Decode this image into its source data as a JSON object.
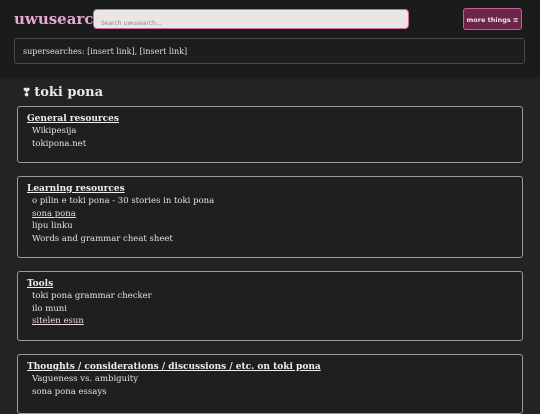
{
  "header": {
    "brand": "uwusearch",
    "search_placeholder": "Search uwusearch...",
    "more_button": "more things ≡"
  },
  "supersearches": "supersearches: [insert link], [insert link]",
  "page": {
    "title": "toki pona",
    "title_icon": "❣"
  },
  "sections": [
    {
      "heading": "General resources",
      "items": [
        "Wikipesija",
        "tokipona.net"
      ]
    },
    {
      "heading": "Learning resources",
      "items": [
        "o pilin e toki pona - 30 stories in toki pona",
        "sona pona",
        "lipu linku",
        "Words and grammar cheat sheet"
      ]
    },
    {
      "heading": "Tools",
      "items": [
        "toki pona grammar checker",
        "ilo muni",
        "sitelen esun"
      ]
    },
    {
      "heading": "Thoughts / considerations / discussions / etc. on toki pona",
      "items": [
        "Vagueness vs. ambiguity",
        "sona pona essays"
      ]
    }
  ]
}
